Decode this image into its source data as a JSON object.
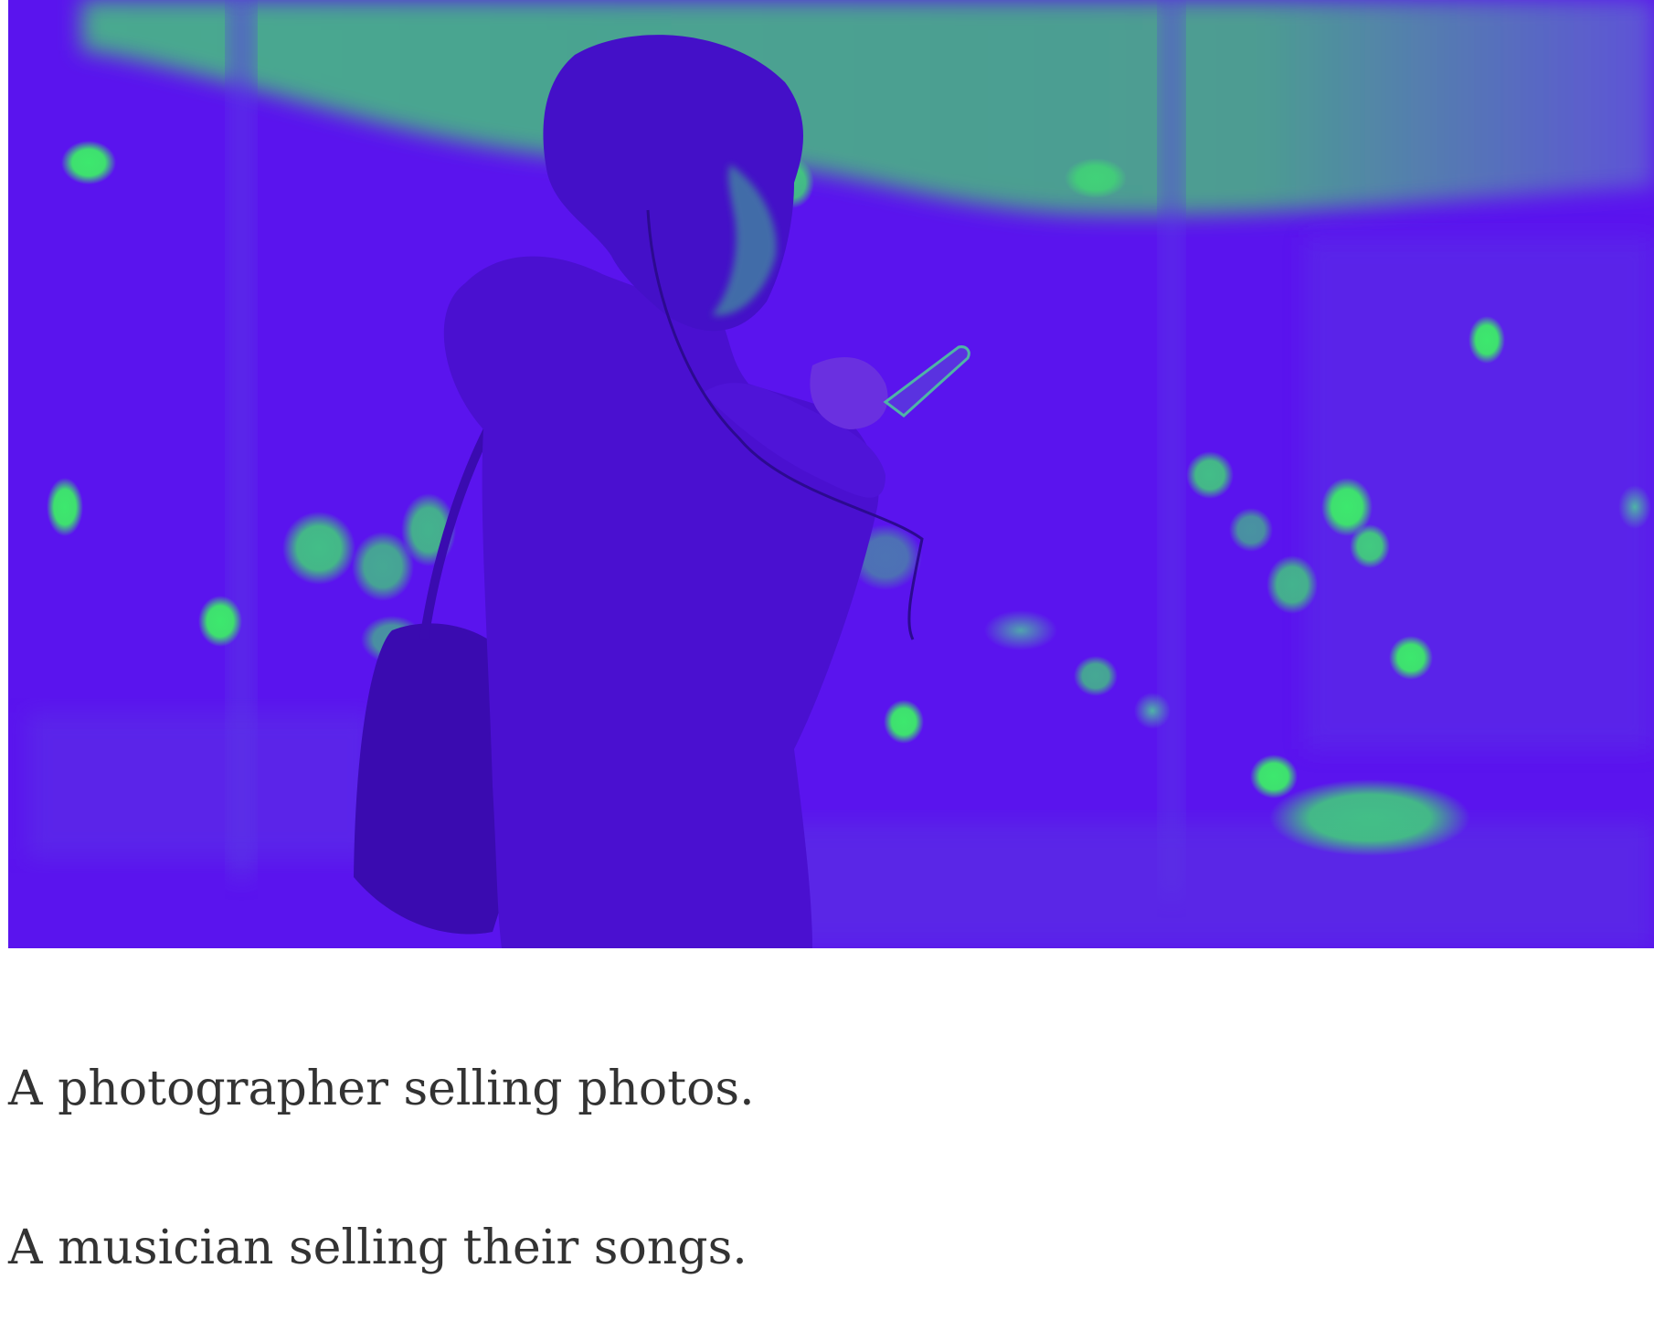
{
  "hero": {
    "image_name": "woman-using-phone-duotone",
    "colors": {
      "shadow": "#5c12f0",
      "highlight": "#3de86e",
      "sky": "#4fa890"
    }
  },
  "captions": [
    "A photographer selling photos.",
    "A musician selling their songs."
  ]
}
